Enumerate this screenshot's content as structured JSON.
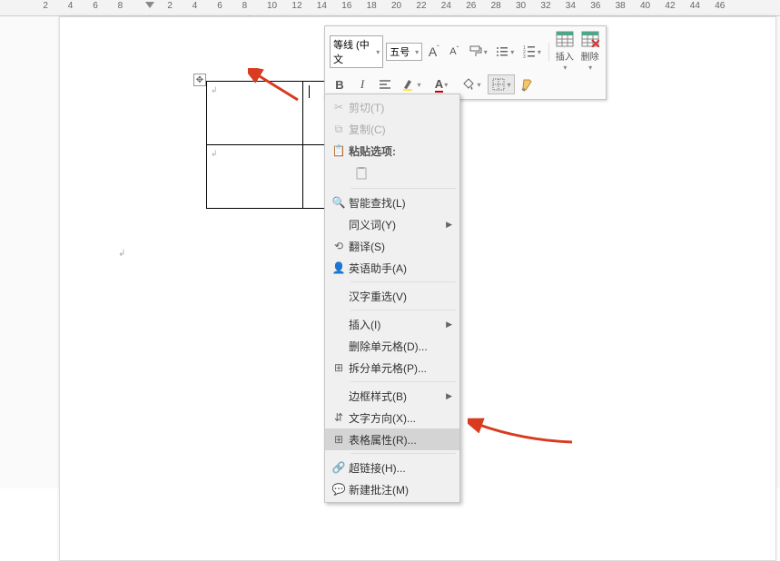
{
  "ruler": {
    "ticks_left": [
      "8",
      "6",
      "4",
      "2"
    ],
    "ticks_right": [
      "2",
      "4",
      "6",
      "8",
      "10",
      "12",
      "14",
      "16",
      "18",
      "20",
      "22",
      "24",
      "26",
      "28",
      "30",
      "32",
      "34",
      "36",
      "38",
      "40",
      "42",
      "44",
      "46"
    ]
  },
  "mini_toolbar": {
    "font": "等线 (中文",
    "size": "五号",
    "grow": "A",
    "shrink": "A",
    "bold": "B",
    "italic": "I",
    "insert_label": "插入",
    "delete_label": "删除"
  },
  "context_menu": {
    "cut": "剪切(T)",
    "copy": "复制(C)",
    "paste_header": "粘贴选项:",
    "smart_lookup": "智能查找(L)",
    "synonyms": "同义词(Y)",
    "translate": "翻译(S)",
    "english_assistant": "英语助手(A)",
    "chinese_reselect": "汉字重选(V)",
    "insert": "插入(I)",
    "delete_cell": "删除单元格(D)...",
    "split_cell": "拆分单元格(P)...",
    "border_style": "边框样式(B)",
    "text_direction": "文字方向(X)...",
    "table_properties": "表格属性(R)...",
    "hyperlink": "超链接(H)...",
    "new_comment": "新建批注(M)"
  },
  "colors": {
    "arrow": "#d83b1f"
  }
}
